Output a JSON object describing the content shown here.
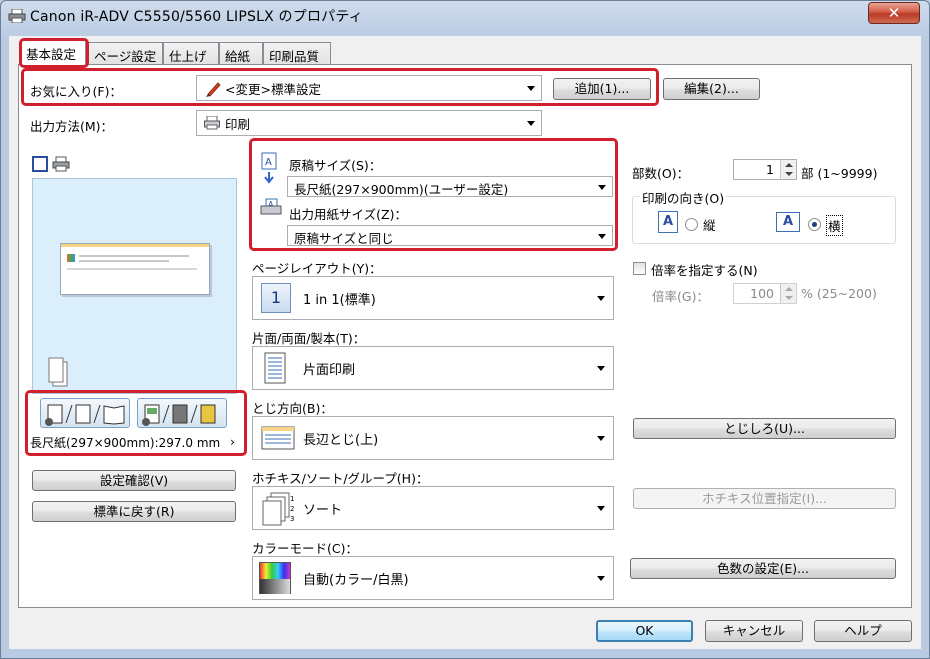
{
  "window": {
    "title": "Canon iR-ADV C5550/5560 LIPSLX のプロパティ",
    "close": "✕"
  },
  "tabs": [
    "基本設定",
    "ページ設定",
    "仕上げ",
    "給紙",
    "印刷品質"
  ],
  "favorites": {
    "label": "お気に入り(F)：",
    "value": "<変更>標準設定",
    "add": "追加(1)...",
    "edit": "編集(2)..."
  },
  "output_method": {
    "label": "出力方法(M)：",
    "value": "印刷"
  },
  "original_size": {
    "label": "原稿サイズ(S)：",
    "value": "長尺紙(297×900mm)(ユーザー設定)"
  },
  "output_size": {
    "label": "出力用紙サイズ(Z)：",
    "value": "原稿サイズと同じ"
  },
  "page_layout": {
    "label": "ページレイアウト(Y)：",
    "value": "1 in 1(標準)",
    "icon_text": "1"
  },
  "duplex": {
    "label": "片面/両面/製本(T)：",
    "value": "片面印刷"
  },
  "binding": {
    "label": "とじ方向(B)：",
    "value": "長辺とじ(上)"
  },
  "staple": {
    "label": "ホチキス/ソート/グループ(H)：",
    "value": "ソート"
  },
  "color_mode": {
    "label": "カラーモード(C)：",
    "value": "自動(カラー/白黒)"
  },
  "copies": {
    "label": "部数(O)：",
    "value": "1",
    "unit": "部 (1~9999)"
  },
  "orientation": {
    "label": "印刷の向き(O)",
    "portrait": "縦",
    "landscape": "横",
    "selected": "landscape"
  },
  "scale": {
    "label": "倍率を指定する(N)",
    "rate_label": "倍率(G)：",
    "value": "100",
    "unit": "% (25~200)"
  },
  "preview": {
    "paper_info": "長尺紙(297×900mm):297.0 mm",
    "more": "›"
  },
  "buttons": {
    "check_settings": "設定確認(V)",
    "restore": "標準に戻す(R)",
    "margin": "とじしろ(U)...",
    "staple_pos": "ホチキス位置指定(I)...",
    "color_count": "色数の設定(E)...",
    "ok": "OK",
    "cancel": "キャンセル",
    "help": "ヘルプ"
  },
  "colors": {
    "highlight": "#d21f2d",
    "preview_bg": "#dbeefb",
    "ok_border": "#3c7fb1"
  }
}
